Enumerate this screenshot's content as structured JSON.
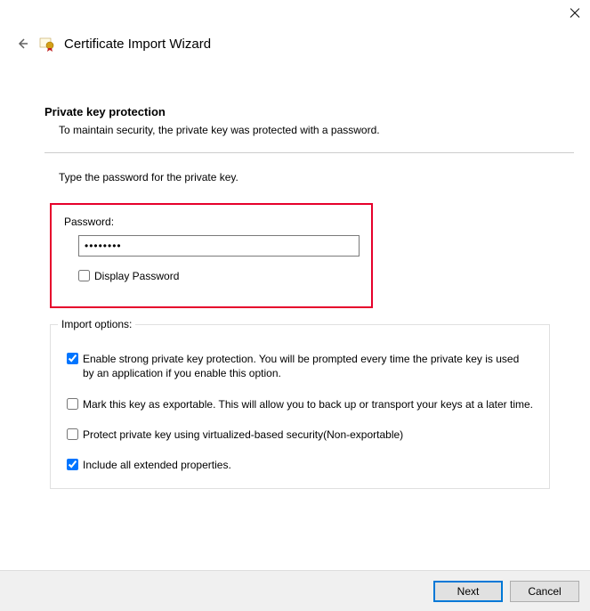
{
  "window": {
    "title": "Certificate Import Wizard"
  },
  "section": {
    "title": "Private key protection",
    "desc": "To maintain security, the private key was protected with a password.",
    "instruction": "Type the password for the private key."
  },
  "password": {
    "label": "Password:",
    "value": "••••••••",
    "display_label": "Display Password",
    "display_checked": false
  },
  "import": {
    "legend": "Import options:",
    "options": [
      {
        "label": "Enable strong private key protection. You will be prompted every time the private key is used by an application if you enable this option.",
        "checked": true
      },
      {
        "label": "Mark this key as exportable. This will allow you to back up or transport your keys at a later time.",
        "checked": false
      },
      {
        "label": "Protect private key using virtualized-based security(Non-exportable)",
        "checked": false
      },
      {
        "label": "Include all extended properties.",
        "checked": true
      }
    ]
  },
  "footer": {
    "next": "Next",
    "cancel": "Cancel"
  }
}
